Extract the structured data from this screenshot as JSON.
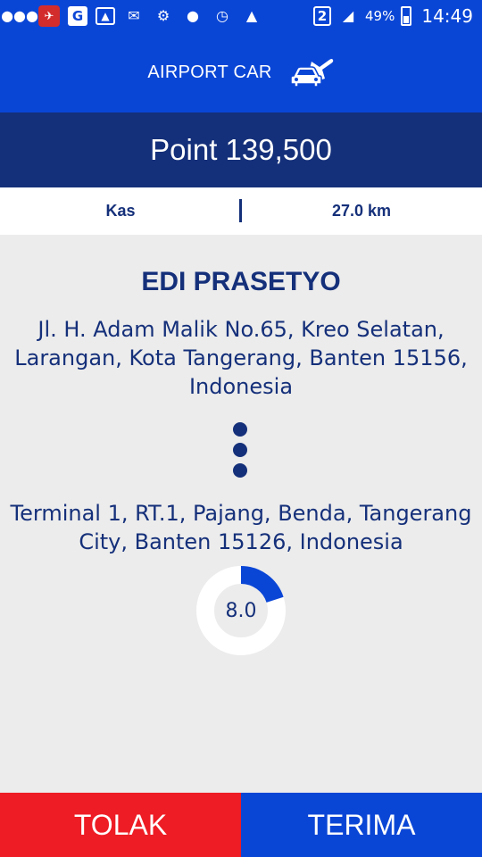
{
  "status_bar": {
    "icons": [
      "chat-icon",
      "app-icon",
      "google-icon",
      "image-icon",
      "mail-icon",
      "tractor-icon",
      "location-icon",
      "alarm-icon",
      "wifi-icon",
      "sim-icon",
      "signal-icon",
      "battery-icon"
    ],
    "sim": "2",
    "battery": "49%",
    "battery_level": 0.49,
    "time": "14:49"
  },
  "header": {
    "title": "AIRPORT CAR",
    "icon": "car-airplane-icon"
  },
  "points": {
    "text": "Point 139,500"
  },
  "info": {
    "payment": "Kas",
    "distance": "27.0 km"
  },
  "order": {
    "customer_name": "EDI PRASETYO",
    "pickup": "Jl. H. Adam Malik No.65, Kreo Selatan, Larangan, Kota Tangerang, Banten 15156, Indonesia",
    "destination": "Terminal 1, RT.1, Pajang, Benda, Tangerang City, Banten 15126, Indonesia",
    "countdown": "8.0",
    "countdown_fraction": 0.2
  },
  "actions": {
    "reject_label": "TOLAK",
    "accept_label": "TERIMA"
  },
  "colors": {
    "primary": "#0a46d6",
    "dark_navy": "#15307a",
    "reject": "#ee1c24",
    "background": "#ececec"
  }
}
